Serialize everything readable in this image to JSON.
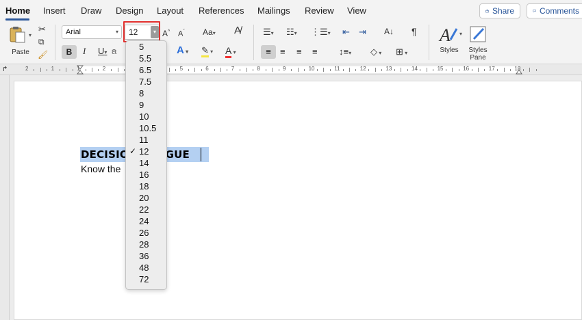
{
  "tabs": [
    "Home",
    "Insert",
    "Draw",
    "Design",
    "Layout",
    "References",
    "Mailings",
    "Review",
    "View"
  ],
  "share_label": "Share",
  "comments_label": "Comments",
  "clipboard": {
    "paste_label": "Paste"
  },
  "font": {
    "name": "Arial",
    "size": "12"
  },
  "styles": {
    "styles_label": "Styles",
    "pane_label_1": "Styles",
    "pane_label_2": "Pane"
  },
  "ruler": {
    "numbers": [
      "2",
      "1",
      "1",
      "2",
      "3",
      "4",
      "5",
      "6",
      "7",
      "8",
      "9",
      "10",
      "11",
      "12",
      "13",
      "14",
      "15",
      "16",
      "17",
      "18"
    ]
  },
  "font_size_dropdown": {
    "options": [
      "5",
      "5.5",
      "6.5",
      "7.5",
      "8",
      "9",
      "10",
      "10.5",
      "11",
      "12",
      "14",
      "16",
      "18",
      "20",
      "22",
      "24",
      "26",
      "28",
      "36",
      "48",
      "72"
    ],
    "selected": "12"
  },
  "document": {
    "heading": "DECISION FATIGUE",
    "body_line": "Know the"
  },
  "colors": {
    "accent": "#2b579a",
    "highlight": "#e3312f",
    "selection": "#b4d0f2"
  }
}
